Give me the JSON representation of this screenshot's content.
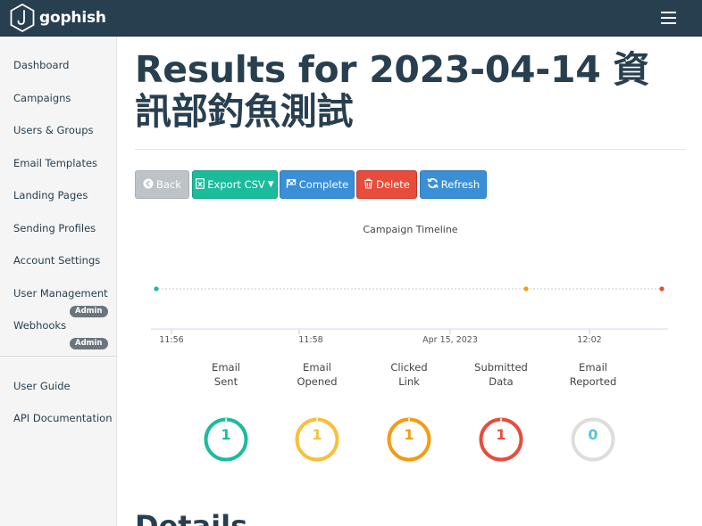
{
  "app": {
    "brand": "gophish"
  },
  "sidebar": {
    "items": [
      {
        "label": "Dashboard"
      },
      {
        "label": "Campaigns"
      },
      {
        "label": "Users & Groups"
      },
      {
        "label": "Email Templates"
      },
      {
        "label": "Landing Pages"
      },
      {
        "label": "Sending Profiles"
      },
      {
        "label": "Account Settings"
      },
      {
        "label": "User Management",
        "badge": "Admin"
      },
      {
        "label": "Webhooks",
        "badge": "Admin"
      }
    ],
    "footer_items": [
      {
        "label": "User Guide"
      },
      {
        "label": "API Documentation"
      }
    ]
  },
  "page": {
    "title": "Results for 2023-04-14 資訊部釣魚測試",
    "section_heading": "Details"
  },
  "toolbar": {
    "back_label": "Back",
    "export_label": "Export CSV",
    "complete_label": "Complete",
    "delete_label": "Delete",
    "refresh_label": "Refresh"
  },
  "timeline": {
    "title": "Campaign Timeline",
    "tick_labels": [
      "11:56",
      "11:58",
      "Apr 15, 2023",
      "12:02"
    ],
    "events": [
      {
        "color": "#1abc9c"
      },
      {
        "color": "#f39c12"
      },
      {
        "color": "#e74c3c"
      }
    ]
  },
  "stats": [
    {
      "line1": "Email",
      "line2": "Sent",
      "value": "1",
      "color": "#1abc9c"
    },
    {
      "line1": "Email",
      "line2": "Opened",
      "value": "1",
      "color": "#f9bf3b"
    },
    {
      "line1": "Clicked",
      "line2": "Link",
      "value": "1",
      "color": "#f39c12"
    },
    {
      "line1": "Submitted",
      "line2": "Data",
      "value": "1",
      "color": "#e74c3c"
    },
    {
      "line1": "Email",
      "line2": "Reported",
      "value": "0",
      "color": "#5bc0de"
    }
  ]
}
